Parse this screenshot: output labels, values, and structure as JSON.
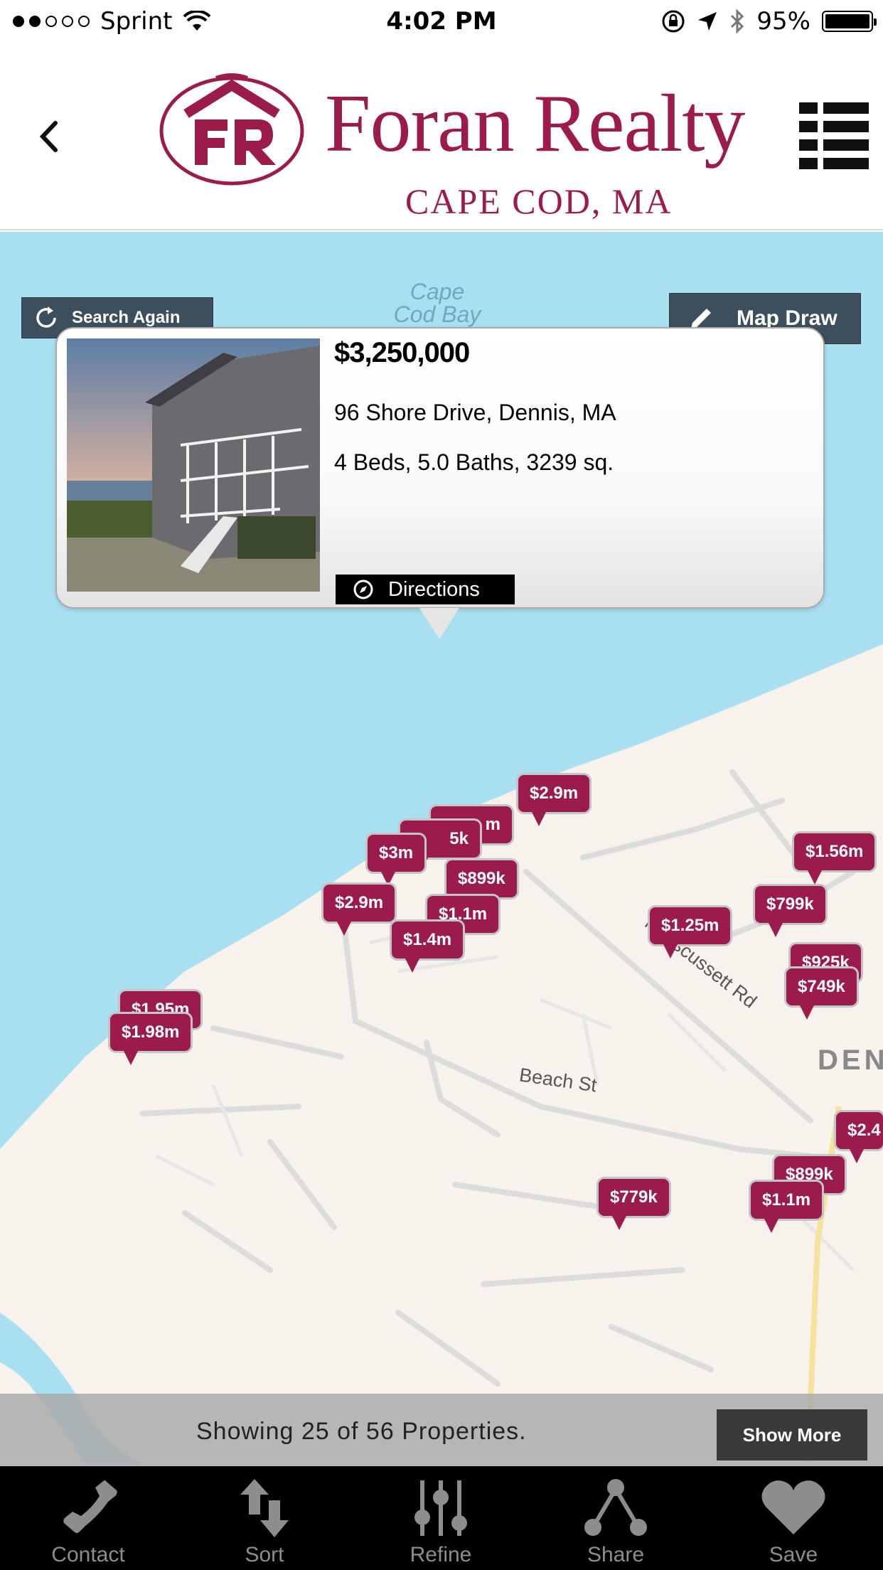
{
  "status_bar": {
    "carrier": "Sprint",
    "time": "4:02 PM",
    "battery": "95%",
    "signal_dots_filled": 2,
    "signal_dots_total": 5
  },
  "header": {
    "logo_name": "Foran Realty",
    "logo_sub": "CAPE COD, MA",
    "logo_mark_text": "FR",
    "brand_color": "#9b1b4b"
  },
  "map": {
    "water_label": "Cape Cod Bay",
    "search_again_label": "Search Again",
    "map_draw_label": "Map Draw",
    "streets": [
      "Nobscussett Rd",
      "Beach St"
    ],
    "town_label": "DEN",
    "pins": [
      "$2.9m",
      "m",
      "5k",
      "$3m",
      "$899k",
      "$2.9m",
      "$1.1m",
      "$1.4m",
      "$1.95m",
      "$1.98m",
      "$1.25m",
      "$799k",
      "$1.56m",
      "$925k",
      "$749k",
      "$2.4",
      "$899k",
      "$1.1m",
      "$779k"
    ]
  },
  "popup": {
    "price": "$3,250,000",
    "address": "96 Shore Drive, Dennis, MA",
    "details": "4 Beds, 5.0 Baths, 3239 sq.",
    "directions_label": "Directions"
  },
  "results": {
    "text": "Showing 25 of 56 Properties.",
    "show_more_label": "Show More"
  },
  "tabs": [
    {
      "label": "Contact",
      "icon": "phone-icon"
    },
    {
      "label": "Sort",
      "icon": "sort-arrows-icon"
    },
    {
      "label": "Refine",
      "icon": "sliders-icon"
    },
    {
      "label": "Share",
      "icon": "share-icon"
    },
    {
      "label": "Save",
      "icon": "heart-icon"
    }
  ],
  "colors": {
    "pin": "#9c1b4d",
    "water": "#a8dff1",
    "land": "#f7f3ec",
    "map_button": "#3d4f5c"
  }
}
